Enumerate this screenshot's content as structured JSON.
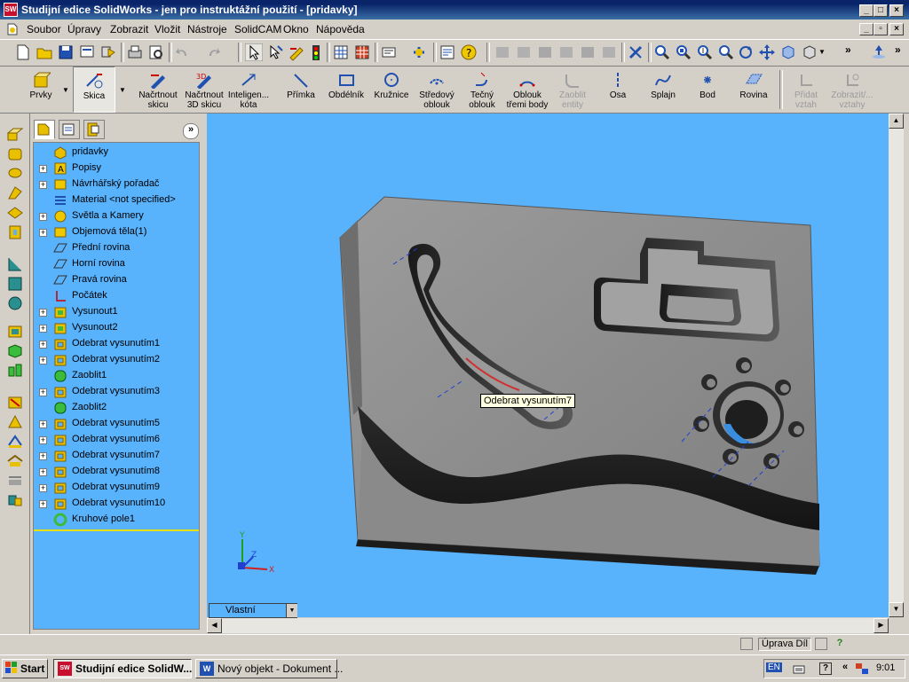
{
  "window": {
    "title": "Studijní edice SolidWorks - jen pro instruktážní použití - [pridavky]"
  },
  "menu": [
    "Soubor",
    "Úpravy",
    "Zobrazit",
    "Vložit",
    "Nástroje",
    "SolidCAM",
    "Okno",
    "Nápověda"
  ],
  "command_manager": {
    "prvky": "Prvky",
    "skica": "Skica",
    "commands": [
      {
        "l1": "Načrtnout",
        "l2": "skicu"
      },
      {
        "l1": "Načrtnout",
        "l2": "3D skicu"
      },
      {
        "l1": "Inteligen...",
        "l2": "kóta"
      },
      {
        "l1": "Přímka",
        "l2": ""
      },
      {
        "l1": "Obdélník",
        "l2": ""
      },
      {
        "l1": "Kružnice",
        "l2": ""
      },
      {
        "l1": "Středový",
        "l2": "oblouk"
      },
      {
        "l1": "Tečný",
        "l2": "oblouk"
      },
      {
        "l1": "Oblouk",
        "l2": "třemi body"
      },
      {
        "l1": "Zaoblit",
        "l2": "entity"
      },
      {
        "l1": "Osa",
        "l2": ""
      },
      {
        "l1": "Splajn",
        "l2": ""
      },
      {
        "l1": "Bod",
        "l2": ""
      },
      {
        "l1": "Rovina",
        "l2": ""
      },
      {
        "l1": "Přidat",
        "l2": "vztah"
      },
      {
        "l1": "Zobrazit/...",
        "l2": "vztahy"
      }
    ]
  },
  "tree": {
    "nodes": [
      {
        "label": "pridavky",
        "expand": false
      },
      {
        "label": "Popisy",
        "expand": true
      },
      {
        "label": "Návrhářský pořadač",
        "expand": true
      },
      {
        "label": "Material <not specified>",
        "expand": false
      },
      {
        "label": "Světla a Kamery",
        "expand": true
      },
      {
        "label": "Objemová těla(1)",
        "expand": true
      },
      {
        "label": "Přední rovina",
        "expand": false
      },
      {
        "label": "Horní rovina",
        "expand": false
      },
      {
        "label": "Pravá rovina",
        "expand": false
      },
      {
        "label": "Počátek",
        "expand": false
      },
      {
        "label": "Vysunout1",
        "expand": true
      },
      {
        "label": "Vysunout2",
        "expand": true
      },
      {
        "label": "Odebrat vysunutím1",
        "expand": true
      },
      {
        "label": "Odebrat vysunutím2",
        "expand": true
      },
      {
        "label": "Zaoblit1",
        "expand": false
      },
      {
        "label": "Odebrat vysunutím3",
        "expand": true
      },
      {
        "label": "Zaoblit2",
        "expand": false
      },
      {
        "label": "Odebrat vysunutím5",
        "expand": true
      },
      {
        "label": "Odebrat vysunutím6",
        "expand": true
      },
      {
        "label": "Odebrat vysunutím7",
        "expand": true
      },
      {
        "label": "Odebrat vysunutím8",
        "expand": true
      },
      {
        "label": "Odebrat vysunutím9",
        "expand": true
      },
      {
        "label": "Odebrat vysunutím10",
        "expand": true
      },
      {
        "label": "Kruhové pole1",
        "expand": false
      }
    ]
  },
  "viewport": {
    "tooltip": "Odebrat vysunutím7",
    "view_select": "Vlastní",
    "triad": {
      "x": "X",
      "y": "Y",
      "z": "Z"
    }
  },
  "status": {
    "edit": "Úprava Díl",
    "help": "?"
  },
  "taskbar": {
    "start": "Start",
    "tasks": [
      "Studijní edice SolidW...",
      "Nový objekt - Dokument ..."
    ],
    "lang": "EN",
    "clock": "9:01",
    "chevron": "«"
  }
}
